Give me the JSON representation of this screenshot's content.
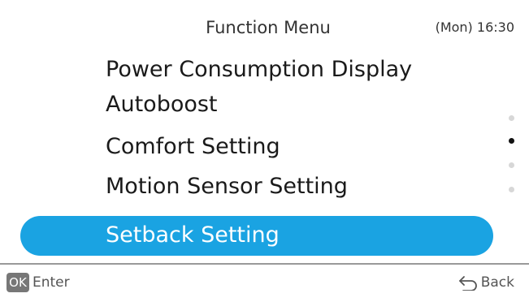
{
  "header": {
    "title": "Function Menu",
    "time": "(Mon) 16:30"
  },
  "menu": {
    "items": [
      {
        "label": "Power Consumption Display"
      },
      {
        "label": "Autoboost"
      },
      {
        "label": "Comfort Setting"
      },
      {
        "label": "Motion Sensor Setting"
      }
    ],
    "selected": {
      "label": "Setback Setting"
    }
  },
  "scroll_indicator": {
    "pages": 4,
    "current_page": 2
  },
  "footer": {
    "ok_key": "OK",
    "ok_action": "Enter",
    "back_label": "Back"
  },
  "colors": {
    "selection": "#1aa3e2",
    "active_dot": "#111111",
    "inactive_dot": "#d7d7d7"
  },
  "icons": {
    "back": "back-arrow-icon"
  }
}
